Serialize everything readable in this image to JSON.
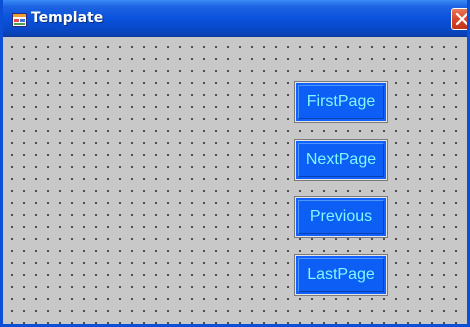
{
  "window": {
    "title": "Template",
    "icon": "app-form-icon",
    "close_icon": "close-icon"
  },
  "buttons": {
    "first": "FirstPage",
    "next": "NextPage",
    "previous": "Previous",
    "last": "LastPage"
  },
  "colors": {
    "titlebar": "#0a52dc",
    "button_face": "#0d5ef5",
    "button_text": "#7ff8ff",
    "close": "#d9472a",
    "client": "#c8c8c8"
  }
}
